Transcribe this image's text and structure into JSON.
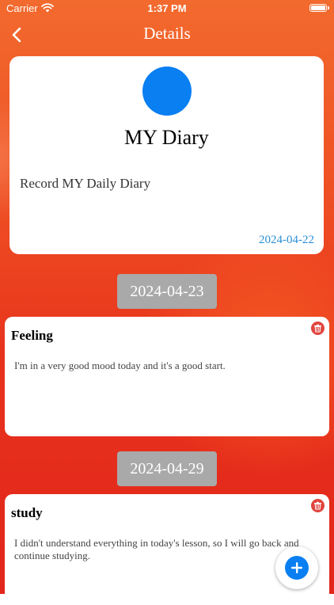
{
  "status_bar": {
    "carrier": "Carrier",
    "time": "1:37 PM",
    "icons": [
      "wifi-icon",
      "battery-icon"
    ]
  },
  "nav": {
    "title": "Details",
    "back_icon": "chevron-left-icon"
  },
  "diary": {
    "title": "MY Diary",
    "description": "Record MY Daily Diary",
    "date": "2024-04-22",
    "avatar_color": "#0a7ff2"
  },
  "entries": [
    {
      "date": "2024-04-23",
      "title": "Feeling",
      "text": "I'm in a very good mood today and it's a good start."
    },
    {
      "date": "2024-04-29",
      "title": "study",
      "text": "I didn't understand everything in today's lesson, so I will go back and continue studying."
    }
  ],
  "actions": {
    "delete_icon": "trash-icon",
    "add_icon": "plus-icon"
  },
  "colors": {
    "background_top": "#f26a2e",
    "background_bottom": "#e2261b",
    "accent_blue": "#0a7ff2",
    "date_link": "#2a8fd6",
    "pill_gray": "#a9a9a9",
    "delete_red": "#e0453e"
  }
}
